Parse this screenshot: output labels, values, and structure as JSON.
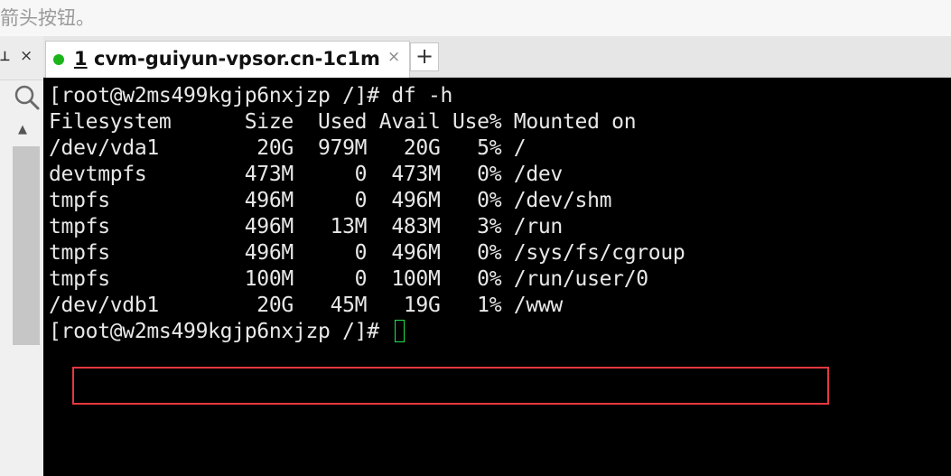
{
  "caption": "箭头按钮。",
  "left_panel": {
    "close_label": "×"
  },
  "tab": {
    "number": "1",
    "title": "cvm-guiyun-vpsor.cn-1c1m",
    "close_label": "×",
    "add_label": "+"
  },
  "terminal": {
    "command_line": "[root@w2ms499kgjp6nxjzp /]# df -h",
    "header": "Filesystem      Size  Used Avail Use% Mounted on",
    "rows": [
      "/dev/vda1        20G  979M   20G   5% /",
      "devtmpfs        473M     0  473M   0% /dev",
      "tmpfs           496M     0  496M   0% /dev/shm",
      "tmpfs           496M   13M  483M   3% /run",
      "tmpfs           496M     0  496M   0% /sys/fs/cgroup",
      "tmpfs           100M     0  100M   0% /run/user/0",
      "/dev/vdb1        20G   45M   19G   1% /www"
    ],
    "prompt": "[root@w2ms499kgjp6nxjzp /]# ",
    "highlight_color": "#e8373f",
    "cursor_color": "#22e04a"
  },
  "status_dot_color": "#1bb51b"
}
